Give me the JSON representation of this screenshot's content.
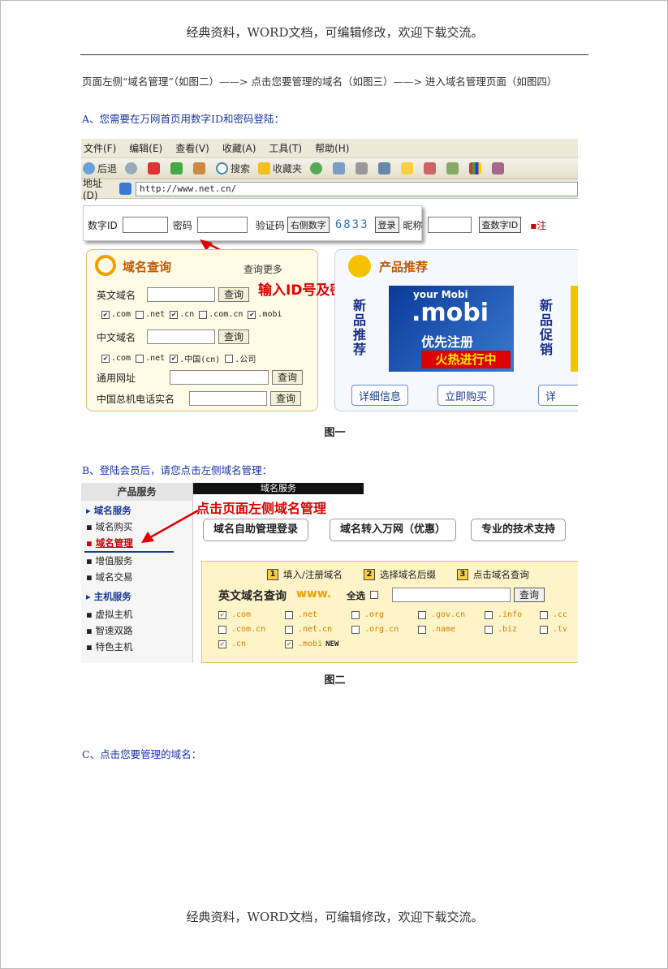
{
  "header": "经典资料，WORD文档，可编辑修改，欢迎下载交流。",
  "footer": "经典资料，WORD文档，可编辑修改，欢迎下载交流。",
  "intro": "页面左侧“域名管理”（如图二）——> 点击您要管理的域名（如图三）——> 进入域名管理页面（如图四）",
  "step_a": "A、您需要在万网首页用数字ID和密码登陆：",
  "step_b": "B、登陆会员后，请您点击左侧域名管理：",
  "step_c": "C、点击您要管理的域名：",
  "caption1": "图一",
  "caption2": "图二",
  "shot1": {
    "menu": [
      "文件(F)",
      "编辑(E)",
      "查看(V)",
      "收藏(A)",
      "工具(T)",
      "帮助(H)"
    ],
    "toolbar": {
      "back": "后退",
      "search": "搜索",
      "favorites": "收藏夹"
    },
    "address_label": "地址(D)",
    "address_value": "http://www.net.cn/",
    "login": {
      "id_label": "数字ID",
      "pwd_label": "密码",
      "code_label": "验证码",
      "code_hint": "右侧数字",
      "code_value": "6833",
      "login_btn": "登录",
      "nick_label": "昵称",
      "check_id_btn": "查数字ID",
      "note": "▪注"
    },
    "domain_panel": {
      "title": "域名查询",
      "more": "查询更多",
      "en_label": "英文域名",
      "cn_label": "中文域名",
      "general_label": "通用网址",
      "phone_label": "中国总机电话实名",
      "query_btn": "查询",
      "en_exts": [
        ".com",
        ".net",
        ".cn",
        ".com.cn",
        ".mobi"
      ],
      "cn_exts": [
        ".com",
        ".net",
        ".中国(cn)",
        ".公司"
      ]
    },
    "annotation": "输入ID号及密码",
    "promo": {
      "title": "产品推荐",
      "new_product": "新品推荐",
      "new_promo": "新品促销",
      "banner_t1": "your Mobi",
      "banner_t2": ".mobi",
      "banner_t3": "优先注册",
      "banner_t4": "火热进行中",
      "detail_btn": "详细信息",
      "buy_btn": "立即购买",
      "detail_btn2": "详"
    }
  },
  "shot2": {
    "sidebar_title": "产品服务",
    "sidebar": [
      {
        "label": "域名服务",
        "type": "sec"
      },
      {
        "label": "域名购买",
        "type": "item"
      },
      {
        "label": "域名管理",
        "type": "hl"
      },
      {
        "label": "增值服务",
        "type": "item"
      },
      {
        "label": "域名交易",
        "type": "item"
      },
      {
        "label": "主机服务",
        "type": "sec"
      },
      {
        "label": "虚拟主机",
        "type": "item"
      },
      {
        "label": "智速双路",
        "type": "item"
      },
      {
        "label": "特色主机",
        "type": "item"
      }
    ],
    "topbar": "域名服务",
    "annotation": "点击页面左侧域名管理",
    "tabs": [
      "域名自助管理登录",
      "域名转入万网（优惠）",
      "专业的技术支持"
    ],
    "steps": [
      "填入/注册域名",
      "选择域名后缀",
      "点击域名查询"
    ],
    "query_title": "英文域名查询",
    "www": "www.",
    "select_all": "全选",
    "query_btn": "查询",
    "exts_row1": [
      ".com",
      ".net",
      ".org",
      ".gov.cn",
      ".info",
      ".cc"
    ],
    "exts_row2": [
      ".com.cn",
      ".net.cn",
      ".org.cn",
      ".name",
      ".biz",
      ".tv"
    ],
    "exts_row3": [
      ".cn",
      ".mobi"
    ],
    "new_tag": "NEW"
  }
}
